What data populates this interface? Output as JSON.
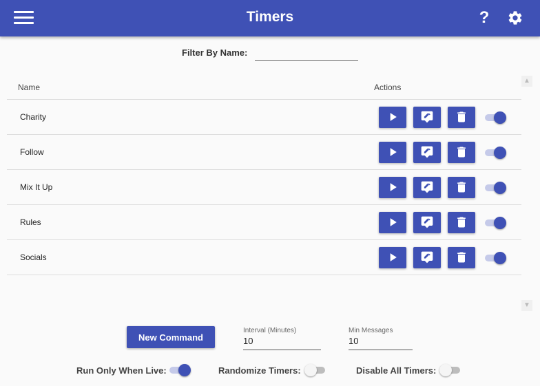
{
  "header": {
    "title": "Timers",
    "help_label": "?",
    "accent_color": "#3f51b5"
  },
  "filter": {
    "label": "Filter By Name:",
    "value": "",
    "placeholder": ""
  },
  "table": {
    "columns": [
      "Name",
      "Actions"
    ],
    "rows": [
      {
        "name": "Charity",
        "enabled": true
      },
      {
        "name": "Follow",
        "enabled": true
      },
      {
        "name": "Mix It Up",
        "enabled": true
      },
      {
        "name": "Rules",
        "enabled": true
      },
      {
        "name": "Socials",
        "enabled": true
      }
    ],
    "row_action_icons": [
      "play-icon",
      "edit-icon",
      "trash-icon"
    ]
  },
  "footer": {
    "new_command_label": "New Command",
    "interval_label": "Interval (Minutes)",
    "interval_value": "10",
    "min_messages_label": "Min Messages",
    "min_messages_value": "10",
    "run_only_when_live_label": "Run Only When Live:",
    "run_only_when_live": true,
    "randomize_timers_label": "Randomize Timers:",
    "randomize_timers": false,
    "disable_all_timers_label": "Disable All Timers:",
    "disable_all_timers": false
  }
}
